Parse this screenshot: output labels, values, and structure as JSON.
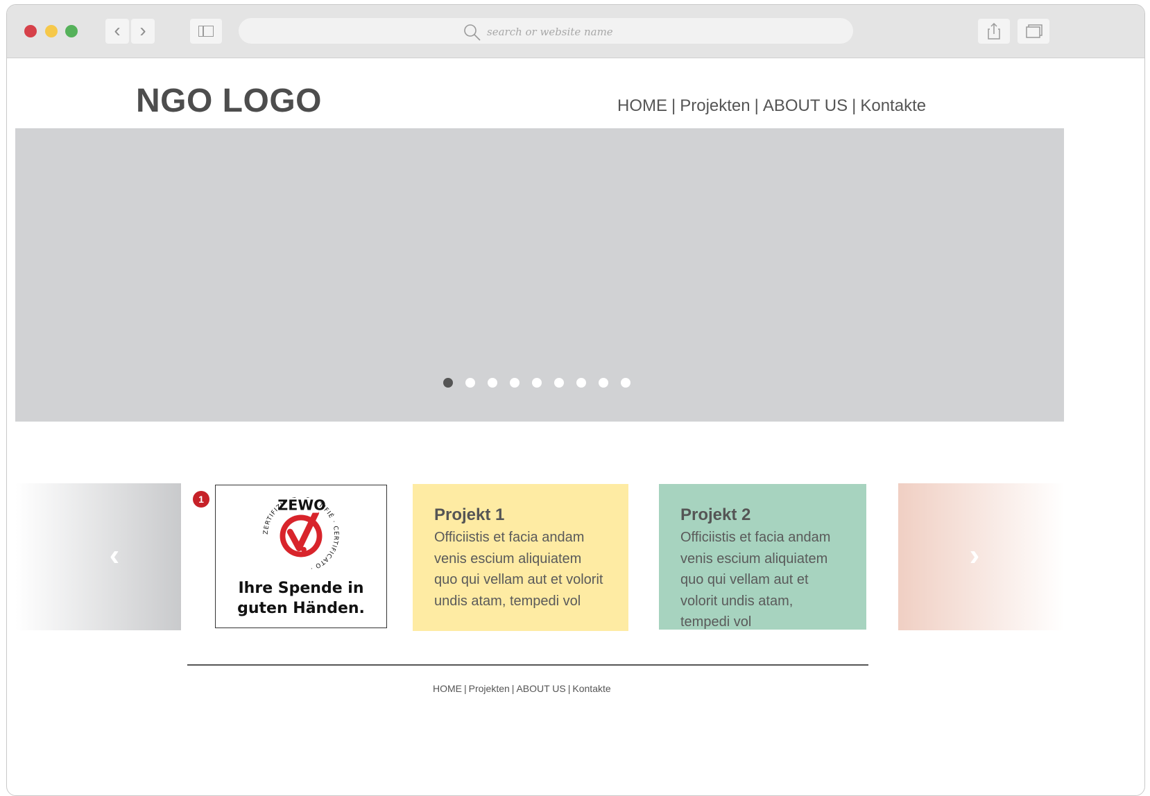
{
  "browser": {
    "url_placeholder": "search or website name",
    "back_icon": "‹",
    "forward_icon": "›"
  },
  "site": {
    "logo": "NGO LOGO",
    "nav": [
      {
        "label": "HOME"
      },
      {
        "label": "Projekten"
      },
      {
        "label": "ABOUT US"
      },
      {
        "label": "Kontakte"
      }
    ],
    "separator": "|"
  },
  "hero": {
    "slide_count": 9,
    "active_slide": 1
  },
  "carousel": {
    "prev_icon": "‹",
    "next_icon": "›",
    "badge": "1",
    "zewo": {
      "seal_word": "ZEWO",
      "seal_ring_de": "ZERTIFIZIERT",
      "seal_ring_fr": "CERTIFIÉ",
      "seal_ring_it": "CERTIFICATO",
      "tagline_line1": "Ihre Spende in",
      "tagline_line2": "guten Händen."
    },
    "projects": [
      {
        "title": "Projekt 1",
        "text": "Officiistis et facia andam venis escium aliquiatem quo qui vellam aut et volorit undis atam, tempedi vol",
        "color": "#feeba3"
      },
      {
        "title": "Projekt 2",
        "text": "Officiistis et facia andam venis escium aliquiatem quo qui vellam aut et volorit undis atam, tempedi vol",
        "color": "#a7d3bf"
      }
    ]
  },
  "footer": {
    "nav": [
      {
        "label": "HOME"
      },
      {
        "label": "Projekten"
      },
      {
        "label": "ABOUT US"
      },
      {
        "label": "Kontakte"
      }
    ]
  },
  "colors": {
    "traffic_red": "#d6414a",
    "traffic_yellow": "#f6c84a",
    "traffic_green": "#55b15a",
    "hero_bg": "#d1d2d4",
    "badge_red": "#c62128"
  }
}
